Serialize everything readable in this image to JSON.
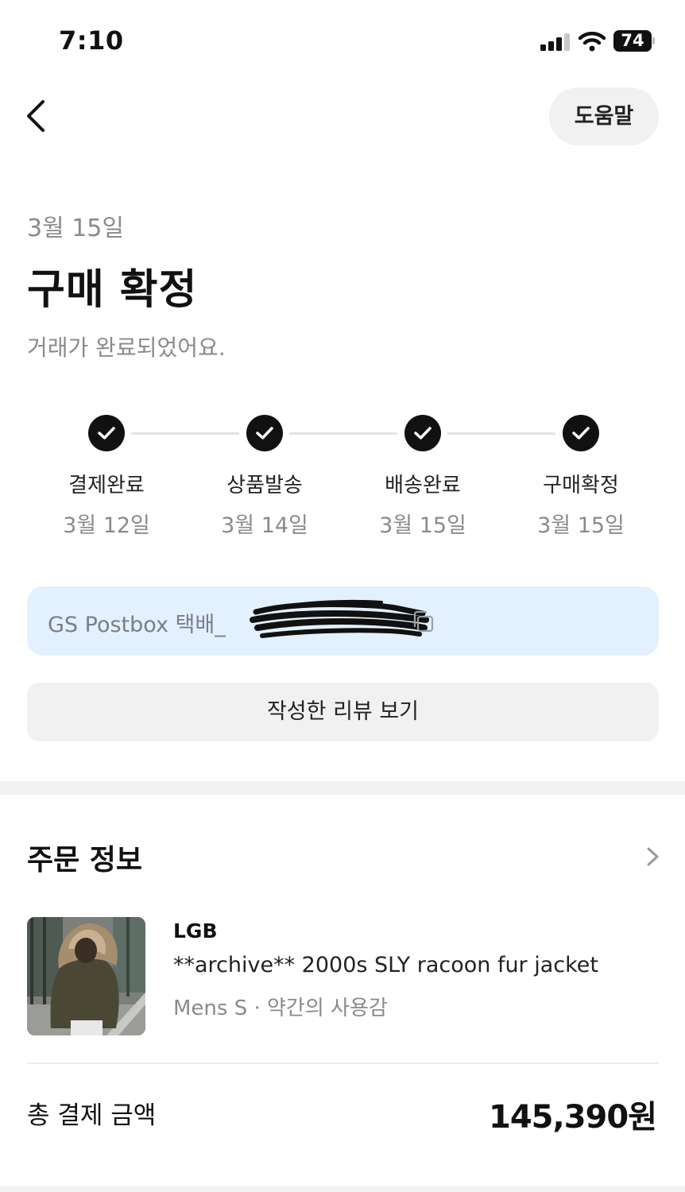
{
  "status_bar": {
    "time": "7:10",
    "battery": "74"
  },
  "header": {
    "help_label": "도움말"
  },
  "status": {
    "date": "3월 15일",
    "title": "구매 확정",
    "subtitle": "거래가 완료되었어요."
  },
  "steps": [
    {
      "label": "결제완료",
      "date": "3월 12일"
    },
    {
      "label": "상품발송",
      "date": "3월 14일"
    },
    {
      "label": "배송완료",
      "date": "3월 15일"
    },
    {
      "label": "구매확정",
      "date": "3월 15일"
    }
  ],
  "tracking": {
    "courier": "GS Postbox 택배_"
  },
  "review_button": {
    "label": "작성한 리뷰 보기"
  },
  "order": {
    "title": "주문 정보",
    "brand": "LGB",
    "name": "**archive** 2000s SLY racoon fur jacket",
    "option": "Mens S · 약간의 사용감",
    "total_label": "총 결제 금액",
    "total_value": "145,390원"
  },
  "colors": {
    "accent_dark": "#111111",
    "tracking_bg": "#e3f0fd",
    "muted_text": "#8a8a8a",
    "button_bg": "#f1f1f1"
  },
  "icons": {
    "back": "chevron-left-icon",
    "check": "check-icon",
    "copy": "copy-icon",
    "more": "chevron-right-icon"
  }
}
